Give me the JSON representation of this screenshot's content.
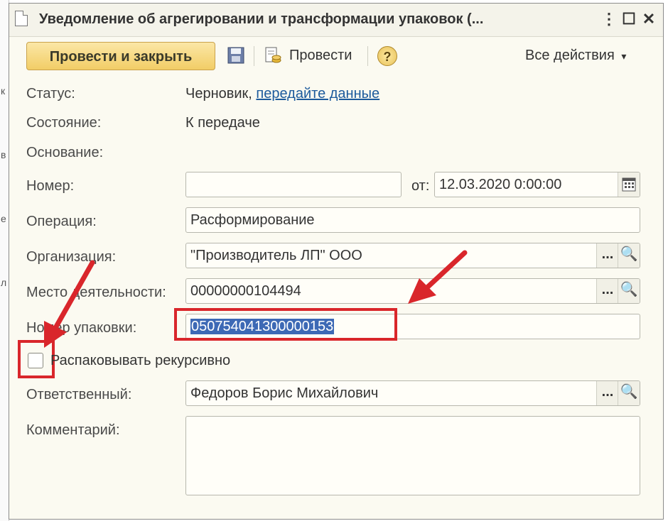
{
  "left_strip": {
    "glyphs": [
      "к",
      "в",
      "е",
      "л"
    ]
  },
  "window": {
    "title": "Уведомление об агрегировании и трансформации упаковок (...",
    "controls": {
      "menu": "⋮",
      "maximize": "☐",
      "close": "✕"
    }
  },
  "toolbar": {
    "post_and_close": "Провести и закрыть",
    "post": "Провести",
    "help": "?",
    "all_actions": "Все действия",
    "all_actions_caret": "▾"
  },
  "form": {
    "status": {
      "label": "Статус:",
      "value": "Черновик,",
      "link": "передайте данные"
    },
    "state": {
      "label": "Состояние:",
      "value": "К передаче"
    },
    "basis": {
      "label": "Основание:"
    },
    "number": {
      "label": "Номер:",
      "value": "",
      "from_label": "от:",
      "date": "12.03.2020  0:00:00"
    },
    "operation": {
      "label": "Операция:",
      "value": "Расформирование"
    },
    "organization": {
      "label": "Организация:",
      "value": "\"Производитель ЛП\" ООО"
    },
    "place": {
      "label": "Место деятельности:",
      "value": "00000000104494"
    },
    "package_number": {
      "label": "Номер упаковки:",
      "value": "050754041300000153"
    },
    "unpack_recursive": {
      "label": "Распаковывать рекурсивно",
      "checked": false
    },
    "responsible": {
      "label": "Ответственный:",
      "value": "Федоров Борис Михайлович"
    },
    "comment": {
      "label": "Комментарий:",
      "value": ""
    },
    "choose_btn": "...",
    "open_btn": "🔍"
  },
  "colors": {
    "accent_red": "#d9262b",
    "selection": "#3d69b5",
    "primary_button": "#f2cd66"
  }
}
